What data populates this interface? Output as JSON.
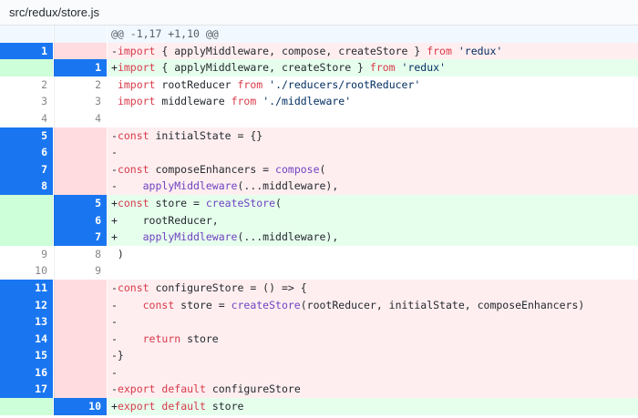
{
  "file_path": {
    "segment1": "src/redux/",
    "segment2": "store.js"
  },
  "hunk_header": "@@ -1,17 +1,10 @@",
  "lines": [
    {
      "type": "del",
      "old": "1",
      "new": "",
      "old_sel": true,
      "new_sel": false,
      "text": "-import { applyMiddleware, compose, createStore } from 'redux'"
    },
    {
      "type": "add",
      "old": "",
      "new": "1",
      "old_sel": false,
      "new_sel": true,
      "text": "+import { applyMiddleware, createStore } from 'redux'"
    },
    {
      "type": "ctx",
      "old": "2",
      "new": "2",
      "old_sel": false,
      "new_sel": false,
      "text": " import rootReducer from './reducers/rootReducer'"
    },
    {
      "type": "ctx",
      "old": "3",
      "new": "3",
      "old_sel": false,
      "new_sel": false,
      "text": " import middleware from './middleware'"
    },
    {
      "type": "ctx",
      "old": "4",
      "new": "4",
      "old_sel": false,
      "new_sel": false,
      "text": ""
    },
    {
      "type": "del",
      "old": "5",
      "new": "",
      "old_sel": true,
      "new_sel": false,
      "text": "-const initialState = {}"
    },
    {
      "type": "del",
      "old": "6",
      "new": "",
      "old_sel": true,
      "new_sel": false,
      "text": "-"
    },
    {
      "type": "del",
      "old": "7",
      "new": "",
      "old_sel": true,
      "new_sel": false,
      "text": "-const composeEnhancers = compose("
    },
    {
      "type": "del",
      "old": "8",
      "new": "",
      "old_sel": true,
      "new_sel": false,
      "text": "-    applyMiddleware(...middleware),"
    },
    {
      "type": "add",
      "old": "",
      "new": "5",
      "old_sel": false,
      "new_sel": true,
      "text": "+const store = createStore("
    },
    {
      "type": "add",
      "old": "",
      "new": "6",
      "old_sel": false,
      "new_sel": true,
      "text": "+    rootReducer,"
    },
    {
      "type": "add",
      "old": "",
      "new": "7",
      "old_sel": false,
      "new_sel": true,
      "text": "+    applyMiddleware(...middleware),"
    },
    {
      "type": "ctx",
      "old": "9",
      "new": "8",
      "old_sel": false,
      "new_sel": false,
      "text": " )"
    },
    {
      "type": "ctx",
      "old": "10",
      "new": "9",
      "old_sel": false,
      "new_sel": false,
      "text": ""
    },
    {
      "type": "del",
      "old": "11",
      "new": "",
      "old_sel": true,
      "new_sel": false,
      "text": "-const configureStore = () => {"
    },
    {
      "type": "del",
      "old": "12",
      "new": "",
      "old_sel": true,
      "new_sel": false,
      "text": "-    const store = createStore(rootReducer, initialState, composeEnhancers)"
    },
    {
      "type": "del",
      "old": "13",
      "new": "",
      "old_sel": true,
      "new_sel": false,
      "text": "-"
    },
    {
      "type": "del",
      "old": "14",
      "new": "",
      "old_sel": true,
      "new_sel": false,
      "text": "-    return store"
    },
    {
      "type": "del",
      "old": "15",
      "new": "",
      "old_sel": true,
      "new_sel": false,
      "text": "-}"
    },
    {
      "type": "del",
      "old": "16",
      "new": "",
      "old_sel": true,
      "new_sel": false,
      "text": "-"
    },
    {
      "type": "del",
      "old": "17",
      "new": "",
      "old_sel": true,
      "new_sel": false,
      "text": "-export default configureStore"
    },
    {
      "type": "add",
      "old": "",
      "new": "10",
      "old_sel": false,
      "new_sel": true,
      "text": "+export default store"
    }
  ],
  "colors": {
    "selection": "#1a76f0",
    "deletion_bg": "#ffeef0",
    "addition_bg": "#e6ffed",
    "hunk_bg": "#f1f8ff"
  }
}
